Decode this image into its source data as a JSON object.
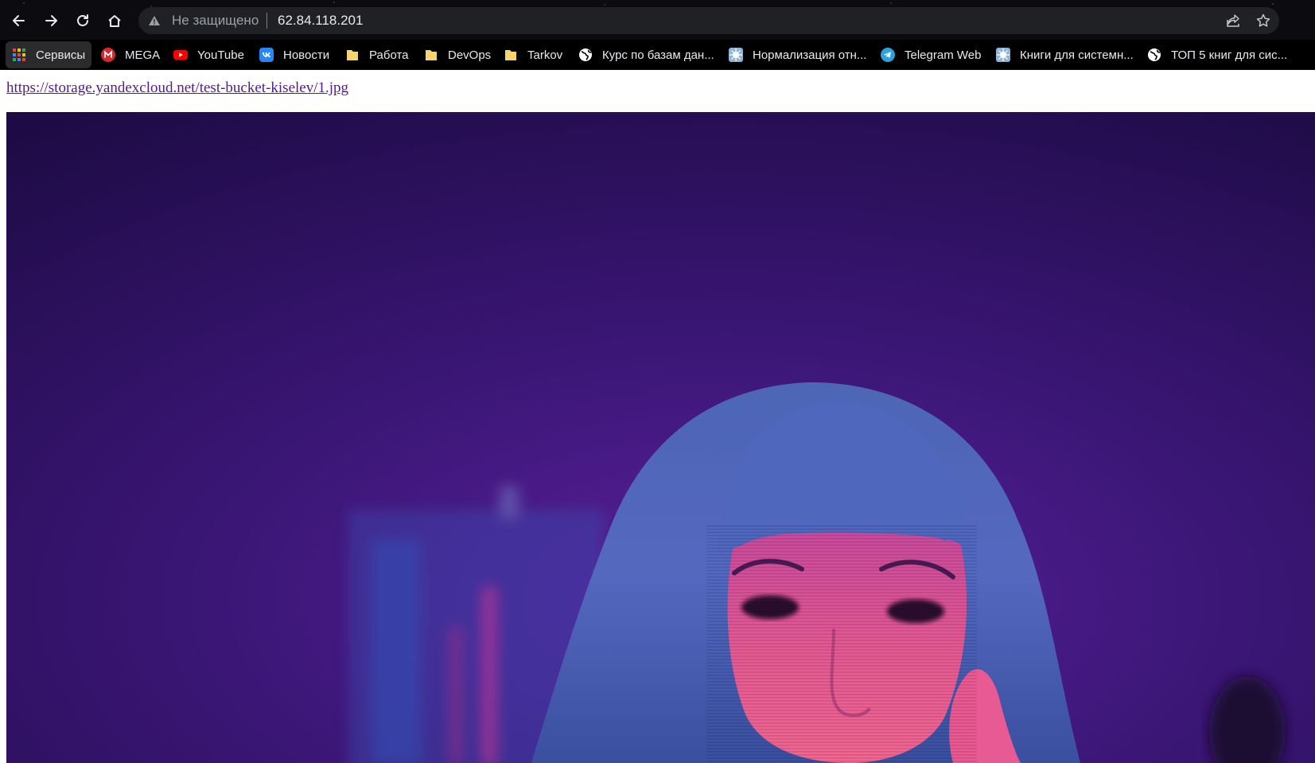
{
  "browser": {
    "address_bar": {
      "security_label": "Не защищено",
      "url": "62.84.118.201"
    },
    "bookmarks": [
      {
        "label": "Сервисы",
        "icon": "apps-grid-icon"
      },
      {
        "label": "MEGA",
        "icon": "mega-icon"
      },
      {
        "label": "YouTube",
        "icon": "youtube-icon"
      },
      {
        "label": "Новости",
        "icon": "vk-icon"
      },
      {
        "label": "Работа",
        "icon": "folder-icon"
      },
      {
        "label": "DevOps",
        "icon": "folder-icon"
      },
      {
        "label": "Tarkov",
        "icon": "folder-icon"
      },
      {
        "label": "Курс по базам дан...",
        "icon": "globe-icon"
      },
      {
        "label": "Нормализация отн...",
        "icon": "site-favicon-icon"
      },
      {
        "label": "Telegram Web",
        "icon": "telegram-icon"
      },
      {
        "label": "Книги для системн...",
        "icon": "site-favicon-icon"
      },
      {
        "label": "ТОП 5 книг для сис...",
        "icon": "globe-icon"
      }
    ]
  },
  "page": {
    "link_text": "https://storage.yandexcloud.net/test-bucket-kiselev/1.jpg",
    "image_subject": "neon-portrait-photo"
  },
  "colors": {
    "toolbar_bg": "#0b0b10",
    "omnibox_bg": "#202124",
    "link_visited": "#551a8b",
    "photo_bg": "#2a0f55",
    "photo_hair": "#4a63b8",
    "photo_face": "#e0508f"
  }
}
